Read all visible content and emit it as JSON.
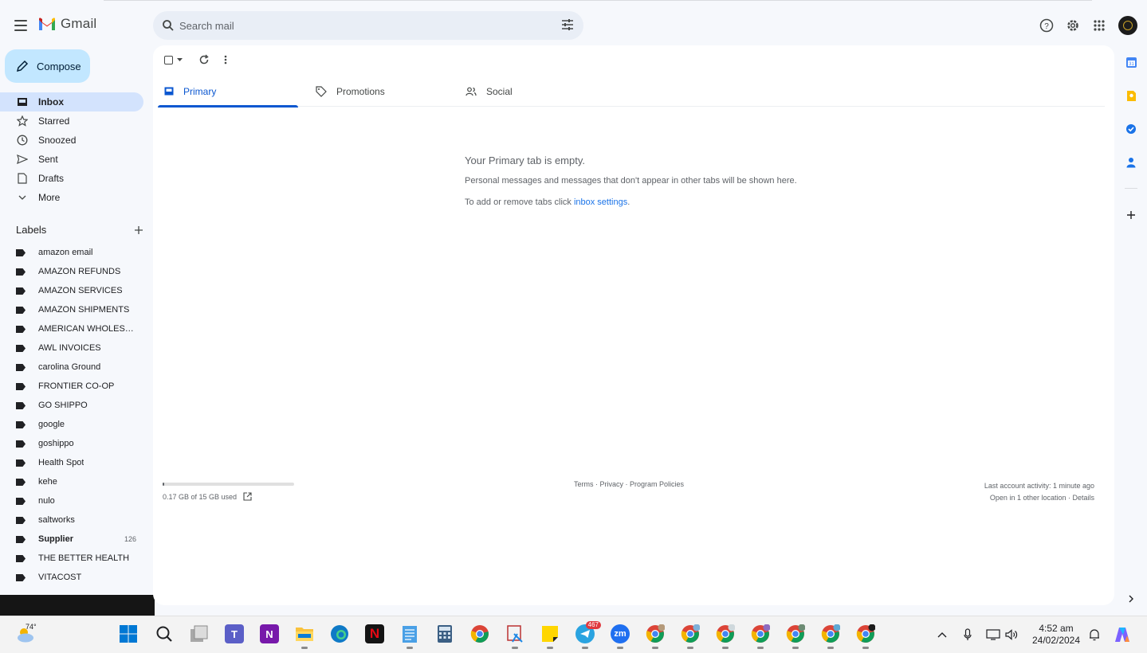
{
  "app": {
    "name": "Gmail"
  },
  "search": {
    "placeholder": "Search mail"
  },
  "compose": {
    "label": "Compose"
  },
  "nav": [
    {
      "label": "Inbox",
      "icon": "inbox-icon",
      "active": true
    },
    {
      "label": "Starred",
      "icon": "star-icon"
    },
    {
      "label": "Snoozed",
      "icon": "clock-icon"
    },
    {
      "label": "Sent",
      "icon": "send-icon"
    },
    {
      "label": "Drafts",
      "icon": "draft-icon"
    },
    {
      "label": "More",
      "icon": "chevron-down-icon"
    }
  ],
  "labels": {
    "title": "Labels",
    "items": [
      {
        "label": "amazon email"
      },
      {
        "label": "AMAZON REFUNDS"
      },
      {
        "label": "AMAZON SERVICES"
      },
      {
        "label": "AMAZON SHIPMENTS"
      },
      {
        "label": "AMERICAN WHOLESAL..."
      },
      {
        "label": "AWL INVOICES"
      },
      {
        "label": "carolina Ground"
      },
      {
        "label": "FRONTIER CO-OP"
      },
      {
        "label": "GO SHIPPO"
      },
      {
        "label": "google"
      },
      {
        "label": "goshippo"
      },
      {
        "label": "Health Spot"
      },
      {
        "label": "kehe"
      },
      {
        "label": "nulo"
      },
      {
        "label": "saltworks"
      },
      {
        "label": "Supplier",
        "count": "126",
        "bold": true
      },
      {
        "label": "THE BETTER HEALTH"
      },
      {
        "label": "VITACOST"
      }
    ]
  },
  "tabs": [
    {
      "label": "Primary",
      "icon": "inbox-tab-icon",
      "active": true
    },
    {
      "label": "Promotions",
      "icon": "tag-icon"
    },
    {
      "label": "Social",
      "icon": "people-icon"
    }
  ],
  "empty": {
    "title": "Your Primary tab is empty.",
    "subtitle": "Personal messages and messages that don't appear in other tabs will be shown here.",
    "settings_prefix": "To add or remove tabs click ",
    "settings_link": "inbox settings",
    "settings_suffix": "."
  },
  "storage": {
    "text": "0.17 GB of 15 GB used",
    "fraction": 0.011
  },
  "footer": {
    "links": "Terms · Privacy · Program Policies",
    "activity": "Last account activity: 1 minute ago",
    "location": "Open in 1 other location · Details"
  },
  "taskbar": {
    "temperature": "74°",
    "time": "4:52 am",
    "date": "24/02/2024",
    "telegram_badge": "467",
    "zoom_label": "zm"
  },
  "colors": {
    "accent": "#0b57d0",
    "compose_bg": "#c2e7ff",
    "active_nav": "#d3e3fd",
    "background": "#f6f8fc"
  }
}
